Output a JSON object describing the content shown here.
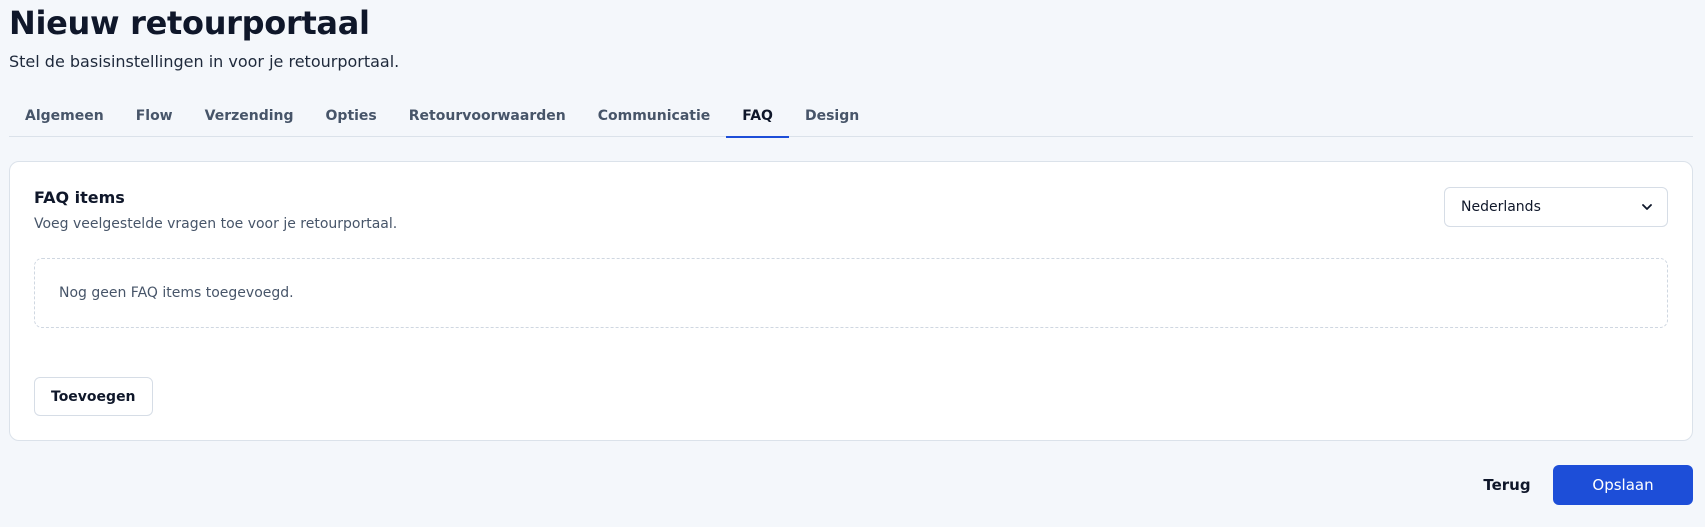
{
  "header": {
    "title": "Nieuw retourportaal",
    "subtitle": "Stel de basisinstellingen in voor je retourportaal."
  },
  "tabs": [
    {
      "label": "Algemeen",
      "active": false
    },
    {
      "label": "Flow",
      "active": false
    },
    {
      "label": "Verzending",
      "active": false
    },
    {
      "label": "Opties",
      "active": false
    },
    {
      "label": "Retourvoorwaarden",
      "active": false
    },
    {
      "label": "Communicatie",
      "active": false
    },
    {
      "label": "FAQ",
      "active": true
    },
    {
      "label": "Design",
      "active": false
    }
  ],
  "faq": {
    "title": "FAQ items",
    "subtitle": "Voeg veelgestelde vragen toe voor je retourportaal.",
    "language_selected": "Nederlands",
    "empty_message": "Nog geen FAQ items toegevoegd.",
    "add_label": "Toevoegen"
  },
  "footer": {
    "back_label": "Terug",
    "save_label": "Opslaan"
  },
  "colors": {
    "accent": "#1d4ed8",
    "background": "#f4f7fb"
  },
  "icons": {
    "select_chevron": "chevron-down-icon"
  }
}
